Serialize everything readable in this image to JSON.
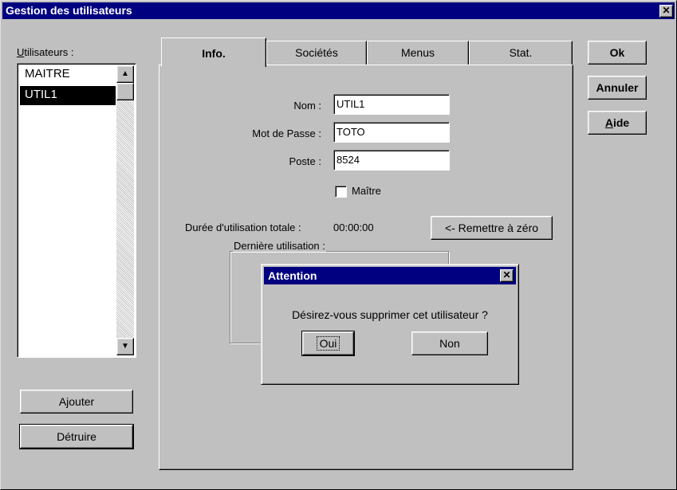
{
  "window": {
    "title": "Gestion des utilisateurs",
    "close_glyph": "✕"
  },
  "users": {
    "label_prefix": "U",
    "label_rest": "tilisateurs :",
    "items": [
      "MAITRE",
      "UTIL1"
    ],
    "selected": "UTIL1"
  },
  "scroll": {
    "up": "▲",
    "down": "▼"
  },
  "left_buttons": {
    "add": "Ajouter",
    "delete": "Détruire"
  },
  "tabs": [
    {
      "label": "Info.",
      "active": true
    },
    {
      "label": "Sociétés",
      "active": false
    },
    {
      "label": "Menus",
      "active": false
    },
    {
      "label": "Stat.",
      "active": false
    }
  ],
  "form": {
    "nom_label": "Nom :",
    "nom_value": "UTIL1",
    "mdp_label": "Mot de Passe :",
    "mdp_value": "TOTO",
    "poste_label": "Poste :",
    "poste_value": "8524",
    "maitre_label": "Maître",
    "maitre_checked": false
  },
  "usage": {
    "total_label": "Durée d'utilisation totale :",
    "total_value": "00:00:00",
    "reset_button": "<- Remettre à zéro",
    "last_label": "Dernière utilisation :"
  },
  "right_buttons": {
    "ok": "Ok",
    "cancel": "Annuler",
    "help_prefix": "A",
    "help_rest": "ide"
  },
  "dialog": {
    "title": "Attention",
    "close_glyph": "✕",
    "message": "Désirez-vous supprimer cet utilisateur ?",
    "yes": "Oui",
    "no": "Non"
  }
}
